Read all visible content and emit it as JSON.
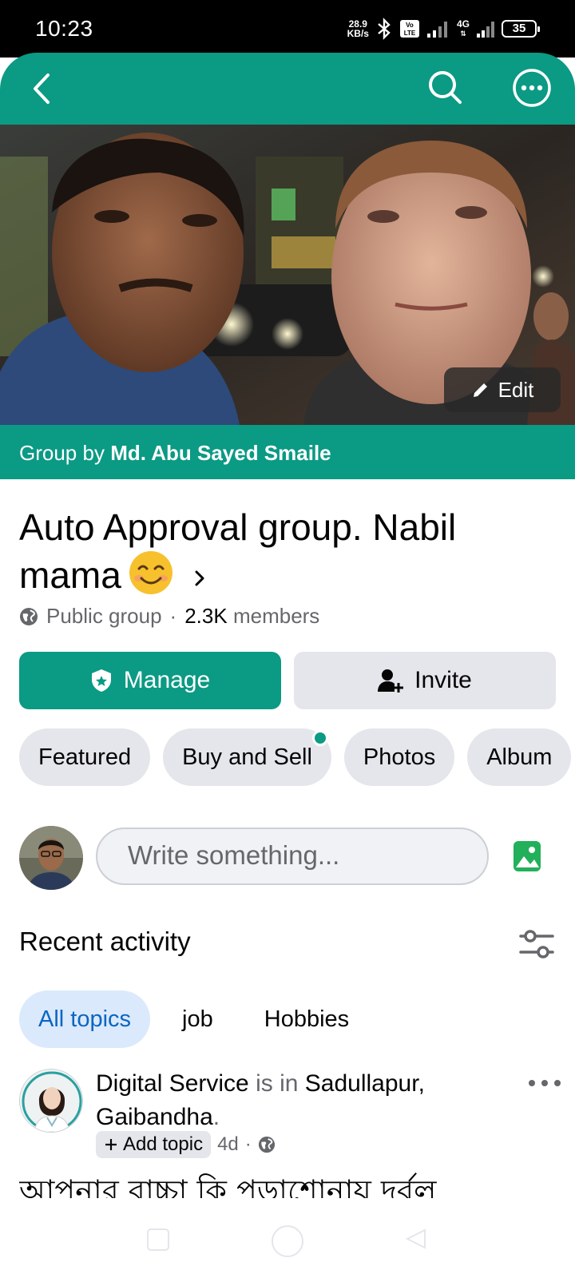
{
  "status_bar": {
    "time": "10:23",
    "speed_value": "28.9",
    "speed_unit": "KB/s",
    "network": "4G",
    "volte": "Vo LTE",
    "battery": "35"
  },
  "app_bar": {
    "back_icon": "back-arrow-icon",
    "search_icon": "search-icon",
    "more_icon": "more-options-icon"
  },
  "cover": {
    "edit_label": "Edit"
  },
  "group": {
    "by_prefix": "Group by",
    "owner": "Md. Abu Sayed Smaile",
    "name": "Auto Approval group. Nabil mama",
    "privacy": "Public group",
    "separator": "·",
    "member_count": "2.3K",
    "members_label": "members"
  },
  "actions": {
    "manage_label": "Manage",
    "invite_label": "Invite"
  },
  "tabs": [
    {
      "label": "Featured",
      "notify": false
    },
    {
      "label": "Buy and Sell",
      "notify": true
    },
    {
      "label": "Photos",
      "notify": false
    },
    {
      "label": "Album",
      "notify": false
    }
  ],
  "composer": {
    "placeholder": "Write something..."
  },
  "recent": {
    "title": "Recent activity",
    "topics": [
      {
        "label": "All topics",
        "active": true
      },
      {
        "label": "job",
        "active": false
      },
      {
        "label": "Hobbies",
        "active": false
      }
    ]
  },
  "post": {
    "author": "Digital Service",
    "is_in": "is in",
    "location": "Sadullapur, Gaibandha",
    "location_end": ".",
    "add_topic": "Add topic",
    "time": "4d",
    "dot": "·",
    "text": "আপনার বাচ্চা কি পড়াশোনায় দুর্বল"
  },
  "colors": {
    "brand": "#0b9a84",
    "chip_bg": "#e4e6eb",
    "topic_active_bg": "#dbe9fc",
    "topic_active_text": "#0a66c2",
    "photo_icon": "#22b05a"
  }
}
